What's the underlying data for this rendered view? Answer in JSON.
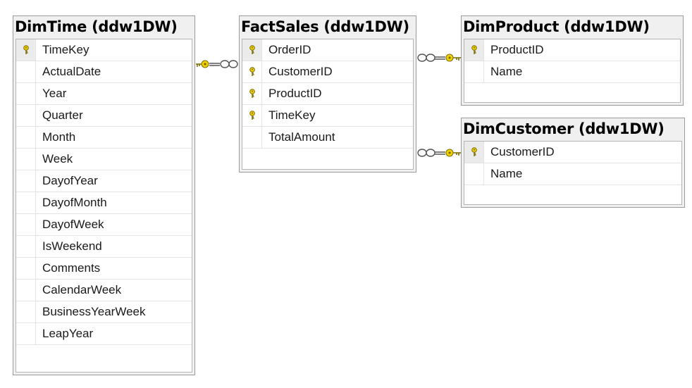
{
  "tables": {
    "dimtime": {
      "title": "DimTime (ddw1DW)",
      "columns": [
        {
          "name": "TimeKey",
          "key": true
        },
        {
          "name": "ActualDate",
          "key": false
        },
        {
          "name": "Year",
          "key": false
        },
        {
          "name": "Quarter",
          "key": false
        },
        {
          "name": "Month",
          "key": false
        },
        {
          "name": "Week",
          "key": false
        },
        {
          "name": "DayofYear",
          "key": false
        },
        {
          "name": "DayofMonth",
          "key": false
        },
        {
          "name": "DayofWeek",
          "key": false
        },
        {
          "name": "IsWeekend",
          "key": false
        },
        {
          "name": "Comments",
          "key": false
        },
        {
          "name": "CalendarWeek",
          "key": false
        },
        {
          "name": "BusinessYearWeek",
          "key": false
        },
        {
          "name": "LeapYear",
          "key": false
        }
      ]
    },
    "factsales": {
      "title": "FactSales (ddw1DW)",
      "columns": [
        {
          "name": "OrderID",
          "key": true
        },
        {
          "name": "CustomerID",
          "key": true
        },
        {
          "name": "ProductID",
          "key": true
        },
        {
          "name": "TimeKey",
          "key": true
        },
        {
          "name": "TotalAmount",
          "key": false
        }
      ]
    },
    "dimproduct": {
      "title": "DimProduct (ddw1DW)",
      "columns": [
        {
          "name": "ProductID",
          "key": true
        },
        {
          "name": "Name",
          "key": false
        }
      ]
    },
    "dimcustomer": {
      "title": "DimCustomer (ddw1DW)",
      "columns": [
        {
          "name": "CustomerID",
          "key": true
        },
        {
          "name": "Name",
          "key": false
        }
      ]
    }
  },
  "relationships": [
    {
      "from": "factsales",
      "to": "dimtime",
      "one_side_icon": "key-icon",
      "many_side_icon": "infinity-icon"
    },
    {
      "from": "factsales",
      "to": "dimproduct",
      "one_side_icon": "key-icon",
      "many_side_icon": "infinity-icon"
    },
    {
      "from": "factsales",
      "to": "dimcustomer",
      "one_side_icon": "key-icon",
      "many_side_icon": "infinity-icon"
    }
  ],
  "colors": {
    "key_fill": "#f2d200",
    "key_stroke": "#7a6a00",
    "line": "#555555"
  }
}
